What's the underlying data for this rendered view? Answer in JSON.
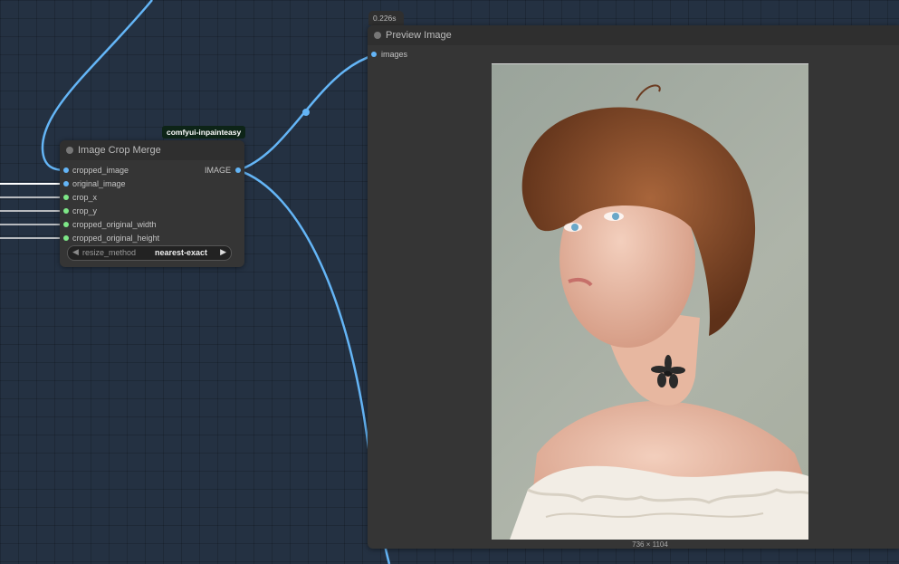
{
  "crop_merge_node": {
    "badge": "comfyui-inpainteasy",
    "title": "Image Crop Merge",
    "inputs": [
      "cropped_image",
      "original_image",
      "crop_x",
      "crop_y",
      "cropped_original_width",
      "cropped_original_height"
    ],
    "output": "IMAGE",
    "widget": {
      "label": "resize_method",
      "value": "nearest-exact"
    }
  },
  "preview_node": {
    "timing": "0.226s",
    "title": "Preview Image",
    "input": "images",
    "image_size": "736 × 1104",
    "image_subject": "portrait of a young woman with short auburn hair, freckles, a flower tattoo on her neck and a white off-shoulder blouse"
  },
  "colors": {
    "canvas": "#243142",
    "node_body": "#353535",
    "wire_image": "#64b5f6",
    "slot_green": "#7ee787",
    "badge_bg": "#0d2417"
  }
}
